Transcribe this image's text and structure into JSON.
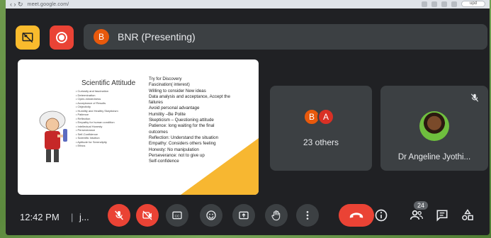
{
  "browser": {
    "url": "meet.google.com/",
    "ext_label": "upd"
  },
  "header": {
    "presenter_initial": "B",
    "presenting_title": "BNR (Presenting)"
  },
  "slide": {
    "title": "Scientific Attitude",
    "left_list": [
      "Curiosity and fascination",
      "Determination",
      "Open-mindedness",
      "Acceptance of Results",
      "Objectivity",
      "Humility and Healthy Skepticism",
      "Patience",
      "Reflection",
      "Empathy for human condition",
      "Intellectual Honesty",
      "Perseverance",
      "Self-Confidence",
      "Scientific Intuition",
      "Aptitude for Serendipity",
      "Ethics"
    ],
    "right_lines": [
      "Try for Discovery",
      "Fascination( interest)",
      "Willing to consider New ideas",
      "Data analysis and acceptance, Accept the",
      "failures",
      "Avoid personal  advantage",
      "Humility –Be Polite",
      "Skepticism – Questioning attitude",
      "Patience: long waiting for the final",
      "outcomes",
      "Reflection: Understand the situation",
      "Empathy: Considers others feeling",
      "Honesty: No manipulation",
      "Perseverance: not to give up",
      "Self-confidence"
    ]
  },
  "tiles": {
    "others": {
      "initial_1": "B",
      "initial_2": "A",
      "label": "23 others"
    },
    "person": {
      "name": "Dr Angeline Jyothi..."
    }
  },
  "bottom": {
    "time": "12:42 PM",
    "separator": "|",
    "meeting_code": "j...",
    "participants_count": "24"
  },
  "colors": {
    "background": "#202124",
    "tile": "#3c4043",
    "red": "#ea4335",
    "yellow": "#f9bb2d",
    "text": "#e8eaed"
  }
}
